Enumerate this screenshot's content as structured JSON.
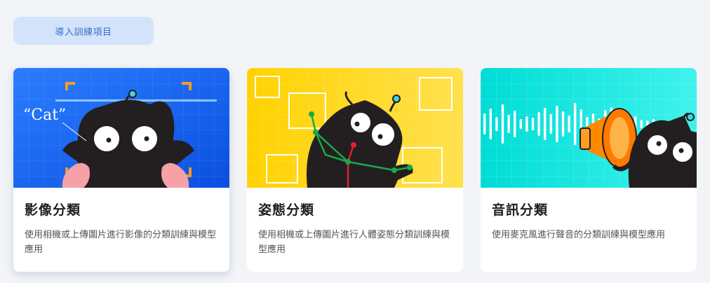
{
  "import_button": {
    "label": "導入訓練項目"
  },
  "cards": [
    {
      "title": "影像分類",
      "description": "使用相機或上傳圖片進行影像的分類訓練與模型應用",
      "illustration_text": "“Cat”",
      "bg_from": "#2a7bff",
      "bg_to": "#0a5ff0"
    },
    {
      "title": "姿態分類",
      "description": "使用相機或上傳圖片進行人體姿態分類訓練與模型應用",
      "bg_from": "#ffd600",
      "bg_to": "#ffe46a"
    },
    {
      "title": "音訊分類",
      "description": "使用麥克風進行聲音的分類訓練與模型應用",
      "bg_from": "#00e0d0",
      "bg_to": "#3cf5e6"
    }
  ]
}
